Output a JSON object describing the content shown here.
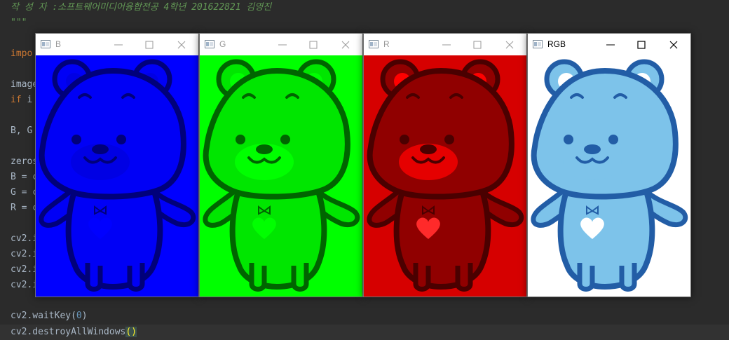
{
  "editor": {
    "lines": [
      {
        "id": "l1",
        "parts": [
          {
            "cls": "comment",
            "text": "작 성 자 :소프트웨어미디어융합전공 4학년 201622821 김영진"
          }
        ]
      },
      {
        "id": "l2",
        "parts": [
          {
            "cls": "comment",
            "text": "\"\"\""
          }
        ]
      },
      {
        "id": "l3",
        "parts": [
          {
            "cls": "kw",
            "text": "impo"
          }
        ]
      },
      {
        "id": "l4",
        "parts": [
          {
            "cls": "",
            "text": "image"
          }
        ]
      },
      {
        "id": "l5",
        "parts": [
          {
            "cls": "kw",
            "text": "if"
          },
          {
            "cls": "",
            "text": " i"
          }
        ]
      },
      {
        "id": "l6",
        "parts": [
          {
            "cls": "",
            "text": "B, G"
          }
        ]
      },
      {
        "id": "l7",
        "parts": [
          {
            "cls": "",
            "text": "zeros"
          }
        ]
      },
      {
        "id": "l8",
        "parts": [
          {
            "cls": "",
            "text": "B = c"
          }
        ]
      },
      {
        "id": "l9",
        "parts": [
          {
            "cls": "",
            "text": "G = c"
          }
        ]
      },
      {
        "id": "l10",
        "parts": [
          {
            "cls": "",
            "text": "R = c"
          }
        ]
      },
      {
        "id": "l11",
        "parts": [
          {
            "cls": "",
            "text": "cv2.i"
          }
        ]
      },
      {
        "id": "l12",
        "parts": [
          {
            "cls": "",
            "text": "cv2.i"
          }
        ]
      },
      {
        "id": "l13",
        "parts": [
          {
            "cls": "",
            "text": "cv2.i"
          }
        ]
      },
      {
        "id": "l14",
        "parts": [
          {
            "cls": "",
            "text": "cv2.i"
          }
        ]
      },
      {
        "id": "l15",
        "parts": [
          {
            "cls": "",
            "text": "cv2.waitKey("
          },
          {
            "cls": "num",
            "text": "0"
          },
          {
            "cls": "",
            "text": ")"
          }
        ]
      },
      {
        "id": "l16",
        "parts": [
          {
            "cls": "",
            "text": "cv2.destroyAllWindows"
          },
          {
            "cls": "paren-hl",
            "text": "()"
          }
        ]
      }
    ]
  },
  "windows": [
    {
      "title": "B",
      "active": false,
      "channel": "blue",
      "colors": {
        "bg": "#0000ff",
        "light": "#0000f6",
        "inner": "#0000e4",
        "pink": "#0000e4",
        "outline": "#00007a",
        "heart": "#0000ff"
      }
    },
    {
      "title": "G",
      "active": false,
      "channel": "green",
      "colors": {
        "bg": "#00ff00",
        "light": "#00e600",
        "inner": "#00ff00",
        "pink": "#00ff00",
        "outline": "#006400",
        "heart": "#00ff00"
      }
    },
    {
      "title": "R",
      "active": false,
      "channel": "red",
      "colors": {
        "bg": "#d60000",
        "light": "#900000",
        "inner": "#ff0000",
        "pink": "#e50000",
        "outline": "#4a0000",
        "heart": "#ff2a2a"
      }
    },
    {
      "title": "RGB",
      "active": true,
      "channel": "rgb",
      "colors": {
        "bg": "#ffffff",
        "light": "#7dc3ea",
        "inner": "#ffffff",
        "pink": "#7dc3ea",
        "outline": "#225da6",
        "heart": "#ffffff"
      }
    }
  ]
}
